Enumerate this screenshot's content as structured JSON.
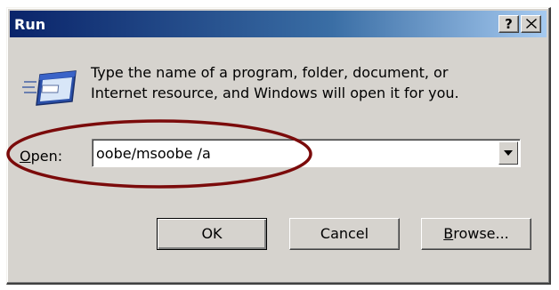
{
  "window": {
    "title": "Run",
    "help_button": "?",
    "close_button": "✕",
    "titlebar_colors": [
      "#0a246a",
      "#a6caf0"
    ]
  },
  "dialog": {
    "icon": "run-icon",
    "description_line1": "Type the name of a program, folder, document, or",
    "description_line2": "Internet resource, and Windows will open it for you.",
    "open_label_underlined": "O",
    "open_label_rest": "pen:",
    "open_value": "oobe/msoobe /a"
  },
  "buttons": {
    "ok": "OK",
    "cancel": "Cancel",
    "browse_underlined": "B",
    "browse_rest": "rowse..."
  },
  "annotation": {
    "highlight_color": "#7b0b0b"
  }
}
